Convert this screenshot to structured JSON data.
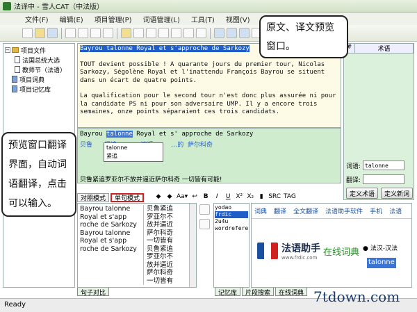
{
  "window": {
    "title": "法译中 - 雪人CAT（中法版）"
  },
  "menu": [
    "文件(F)",
    "编辑(E)",
    "项目管理(P)",
    "词语管理(L)",
    "工具(T)",
    "视图(V)",
    "帮助(H)"
  ],
  "tree": {
    "items": [
      {
        "label": "项目文件",
        "level": 0,
        "kind": "folder"
      },
      {
        "label": "法国总统大选",
        "level": 1,
        "kind": "doc"
      },
      {
        "label": "教师节（法语）",
        "level": 1,
        "kind": "doc"
      },
      {
        "label": "项目词典",
        "level": 0,
        "kind": "book"
      },
      {
        "label": "项目记忆库",
        "level": 0,
        "kind": "book"
      }
    ]
  },
  "preview": {
    "heading": "Bayrou talonne Royal et s'approche de Sarkozy",
    "para1": "TOUT devient possible ! A quarante jours du premier tour, Nicolas Sarkozy, Ségolène Royal et l'inattendu François Bayrou se situent dans un écart de quatre points.",
    "para2": "La qualification pour le second tour n'est donc plus assurée ni pour la candidate PS ni pour son adversaire UMP. Il y a encore trois semaines, onze points séparaient ces trois candidats."
  },
  "translate": {
    "source_words": [
      "Bayrou",
      "talonne",
      "Royal",
      "et s'",
      "approche de",
      "Sarkozy"
    ],
    "selected_word": "talonne",
    "target_line": "贝鲁      紧追            遍近         …的  萨尔科奇",
    "suggestions": [
      "talonne",
      "紧追"
    ],
    "result": "贝鲁紧追罗亚尔不放并逼近萨尔科奇 一切皆有可能!"
  },
  "right_panel": {
    "header": "术语",
    "term_label": "词语:",
    "term_value": "talonne",
    "translation_label": "翻译:",
    "translation_value": "",
    "define_term_btn": "定义术语",
    "define_new_btn": "定义新词"
  },
  "modes": {
    "mode1": "对照模式",
    "mode2": "单句模式"
  },
  "sentences": {
    "src": [
      "Bayrou talonne Royal et s'app roche de Sarkozy",
      "Bayrou talonne Royal et s'app roche de Sarkozy"
    ],
    "tgt": [
      "贝鲁紧追罗亚尔不放并逼近萨尔科奇一切皆有",
      "贝鲁紧追罗亚尔不放并逼近萨尔科奇一切皆有"
    ]
  },
  "memory_list": [
    "yodao",
    "frdic",
    "2u4u",
    "wordrefere"
  ],
  "dict": {
    "tabs": [
      "词典",
      "翻译",
      "全文翻译",
      "法语助手软件",
      "手机",
      "法语"
    ],
    "brand": "法语助手",
    "brand_sub": "www.frdic.com",
    "online": "在线词典",
    "radio": "● 法汉-汉法",
    "search_value": "talonne"
  },
  "bottom_tabs": [
    "句子对比",
    "记忆库",
    "片段搜索",
    "在线词典"
  ],
  "status": "Ready",
  "callouts": {
    "top": "原文、译文预览窗口。",
    "left": "预览窗口翻译界面，自动词语翻译，点击可以输入。"
  },
  "watermark": "7tdown.com"
}
